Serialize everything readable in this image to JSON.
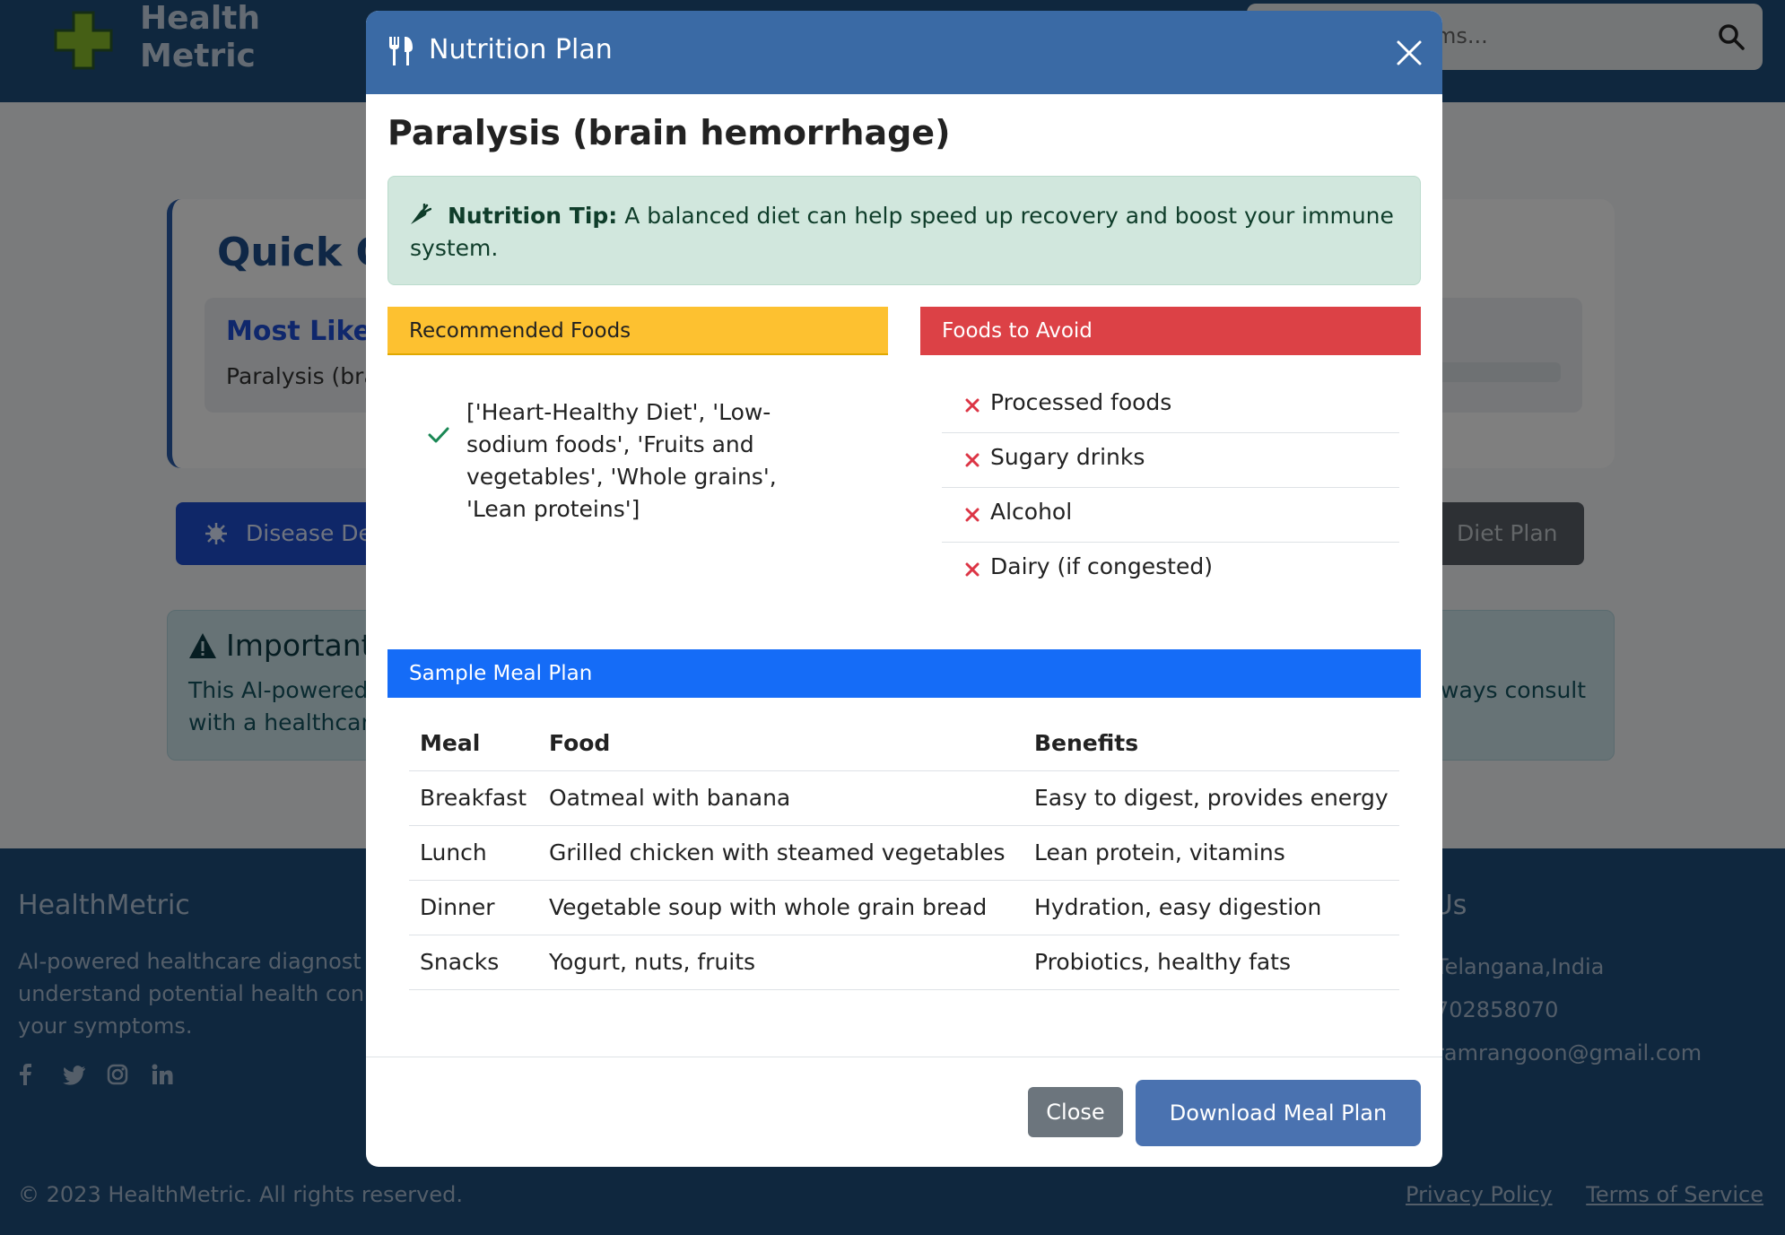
{
  "app": {
    "logo_text_line1": "Health",
    "logo_text_line2": "Metric",
    "search_placeholder_visible": "ms..."
  },
  "background": {
    "card_title": "Quick O",
    "most_likely": "Most Likely",
    "predicted_partial": "Paralysis (bra",
    "disease_button_label": "Disease De",
    "diet_button_label": "Diet Plan",
    "alert_title": "Important",
    "alert_text_left_1": "This AI-powered",
    "alert_text_left_2": "with a healthcare",
    "alert_text_right": "ways consult",
    "progress_fraction": 0.2
  },
  "footer": {
    "brand": "HealthMetric",
    "desc_1": "AI-powered healthcare diagnost",
    "desc_2": "understand potential health con",
    "desc_3": "your symptoms.",
    "contact_title": "ct Us",
    "contact_location": "Telangana,India",
    "contact_phone": "702858070",
    "contact_email": "ramrangoon@gmail.com",
    "copyright": "© 2023 HealthMetric. All rights reserved.",
    "privacy": "Privacy Policy",
    "terms": "Terms of Service"
  },
  "modal": {
    "title": "Nutrition Plan",
    "disease": "Paralysis (brain hemorrhage)",
    "tip_label": "Nutrition Tip:",
    "tip_text": " A balanced diet can help speed up recovery and boost your immune system.",
    "recommended_header": "Recommended Foods",
    "recommended_item": "['Heart-Healthy Diet', 'Low-sodium foods', 'Fruits and vegetables', 'Whole grains', 'Lean proteins']",
    "avoid_header": "Foods to Avoid",
    "avoid_items": [
      "Processed foods",
      "Sugary drinks",
      "Alcohol",
      "Dairy (if congested)"
    ],
    "meal_header": "Sample Meal Plan",
    "table_headers": [
      "Meal",
      "Food",
      "Benefits"
    ],
    "meals": [
      {
        "meal": "Breakfast",
        "food": "Oatmeal with banana",
        "benefits": "Easy to digest, provides energy"
      },
      {
        "meal": "Lunch",
        "food": "Grilled chicken with steamed vegetables",
        "benefits": "Lean protein, vitamins"
      },
      {
        "meal": "Dinner",
        "food": "Vegetable soup with whole grain bread",
        "benefits": "Hydration, easy digestion"
      },
      {
        "meal": "Snacks",
        "food": "Yogurt, nuts, fruits",
        "benefits": "Probiotics, healthy fats"
      }
    ],
    "close_label": "Close",
    "download_label": "Download Meal Plan"
  }
}
